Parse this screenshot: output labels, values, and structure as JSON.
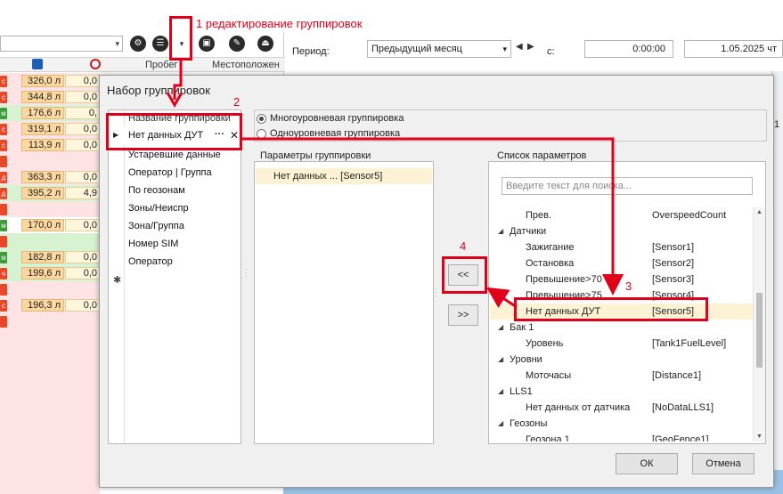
{
  "background": {
    "header_pobeg": "Пробег",
    "header_location": "Местоположен",
    "period_label": "Период:",
    "period_value": "Предыдущий месяц",
    "c_label": "с:",
    "time_value": "0:00:00",
    "date_value": "1.05.2025 чт",
    "right_col_text": "1",
    "rows": [
      {
        "badge": "с",
        "badge_color": "#e8482a",
        "v1": "326,0 л",
        "v2": "0,0",
        "bg": "pink"
      },
      {
        "badge": "с",
        "badge_color": "#e8482a",
        "v1": "344,8 л",
        "v2": "0,0",
        "bg": "pink"
      },
      {
        "badge": "м",
        "badge_color": "#3f9a3a",
        "v1": "176,6 л",
        "v2": "0,",
        "bg": "green"
      },
      {
        "badge": "с",
        "badge_color": "#e8482a",
        "v1": "319,1 л",
        "v2": "0,0",
        "bg": "pink"
      },
      {
        "badge": "с",
        "badge_color": "#e8482a",
        "v1": "113,9 л",
        "v2": "0,0",
        "bg": "pink"
      },
      {
        "badge": "",
        "badge_color": "#e8482a",
        "v1": "",
        "v2": "",
        "bg": "pink"
      },
      {
        "badge": "д",
        "badge_color": "#e8482a",
        "v1": "363,3 л",
        "v2": "0,0",
        "bg": "pink"
      },
      {
        "badge": "д",
        "badge_color": "#e8482a",
        "v1": "395,2 л",
        "v2": "4,9",
        "bg": "green"
      },
      {
        "badge": "",
        "badge_color": "#e8482a",
        "v1": "",
        "v2": "",
        "bg": "pink"
      },
      {
        "badge": "м",
        "badge_color": "#3f9a3a",
        "v1": "170,0 л",
        "v2": "0,0",
        "bg": "white"
      },
      {
        "badge": "",
        "badge_color": "#e8482a",
        "v1": "",
        "v2": "",
        "bg": "green"
      },
      {
        "badge": "м",
        "badge_color": "#3f9a3a",
        "v1": "182,8 л",
        "v2": "0,0",
        "bg": "green"
      },
      {
        "badge": "ч",
        "badge_color": "#e8482a",
        "v1": "199,6 л",
        "v2": "0,0",
        "bg": "green"
      },
      {
        "badge": "",
        "badge_color": "#e8482a",
        "v1": "",
        "v2": "",
        "bg": "pink"
      },
      {
        "badge": "с",
        "badge_color": "#e8482a",
        "v1": "196,3 л",
        "v2": "0,0",
        "bg": "pink"
      },
      {
        "badge": "",
        "badge_color": "#e8482a",
        "v1": "",
        "v2": "",
        "bg": "pink"
      }
    ]
  },
  "dialog": {
    "title": "Набор группировок",
    "left_list": {
      "partial_top": "Название группировки",
      "selected": "Нет данных ДУТ",
      "more_label": "···",
      "close_label": "✕",
      "items": [
        "Устаревшие данные",
        "Оператор | Группа",
        "По геозонам",
        "Зоны/Неиспр",
        "Зона/Группа",
        "Номер SIM",
        "Оператор"
      ],
      "new_row_marker": "✱"
    },
    "radio_multi": "Многоуровневая группировка",
    "radio_single": "Одноуровневая группировка",
    "params_title": "Параметры группировки",
    "params_row": "Нет данных ...   [Sensor5]",
    "btn_add": "<<",
    "btn_remove": ">>",
    "list_title": "Список параметров",
    "search_placeholder": "Введите текст для поиска...",
    "tree": [
      {
        "lvl": 2,
        "name": "Прев.",
        "val": "OverspeedCount",
        "sel": false
      },
      {
        "lvl": 1,
        "name": "Датчики",
        "val": "",
        "sel": false
      },
      {
        "lvl": 2,
        "name": "Зажигание",
        "val": "[Sensor1]",
        "sel": false
      },
      {
        "lvl": 2,
        "name": "Остановка",
        "val": "[Sensor2]",
        "sel": false
      },
      {
        "lvl": 2,
        "name": "Превышение>70",
        "val": "[Sensor3]",
        "sel": false
      },
      {
        "lvl": 2,
        "name": "Превышение>75",
        "val": "[Sensor4]",
        "sel": false
      },
      {
        "lvl": 2,
        "name": "Нет данных ДУТ",
        "val": "[Sensor5]",
        "sel": true
      },
      {
        "lvl": 1,
        "name": "Бак 1",
        "val": "",
        "sel": false
      },
      {
        "lvl": 2,
        "name": "Уровень",
        "val": "[Tank1FuelLevel]",
        "sel": false
      },
      {
        "lvl": 1,
        "name": "Уровни",
        "val": "",
        "sel": false
      },
      {
        "lvl": 2,
        "name": "Моточасы",
        "val": "[Distance1]",
        "sel": false
      },
      {
        "lvl": 1,
        "name": "LLS1",
        "val": "",
        "sel": false
      },
      {
        "lvl": 2,
        "name": "Нет данных от датчика",
        "val": "[NoDataLLS1]",
        "sel": false
      },
      {
        "lvl": 1,
        "name": "Геозоны",
        "val": "",
        "sel": false
      },
      {
        "lvl": 2,
        "name": "Геозона 1",
        "val": "[GeoFence1]",
        "sel": false
      }
    ],
    "ok": "ОК",
    "cancel": "Отмена"
  },
  "annotations": {
    "step1": "1 редактирование группировок",
    "step2": "2",
    "step3": "3",
    "step4": "4",
    "color": "#e0001a"
  }
}
